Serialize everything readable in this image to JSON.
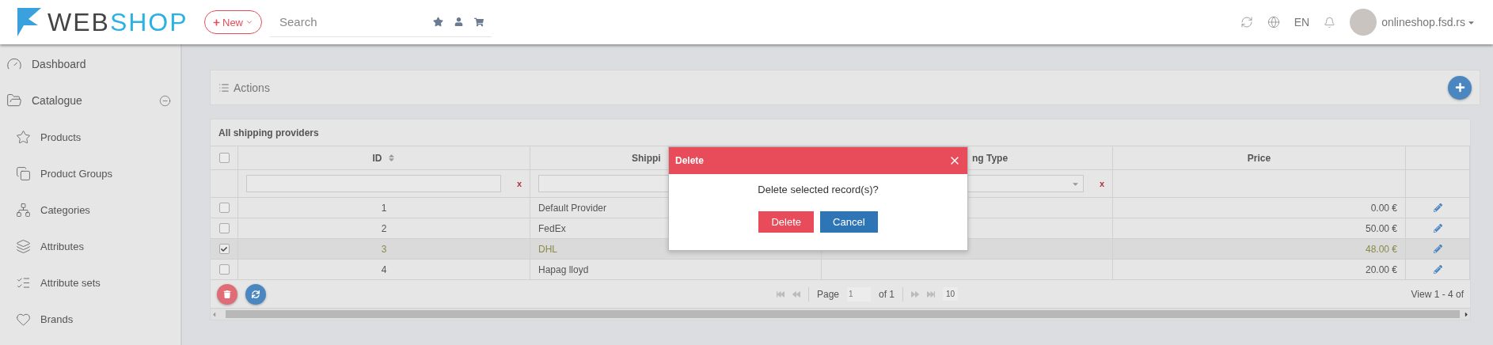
{
  "header": {
    "logo": {
      "dark": "WEB",
      "light": "SHOP"
    },
    "new_button": "New",
    "search": {
      "placeholder": "Search"
    },
    "language": "EN",
    "user": "onlineshop.fsd.rs"
  },
  "sidebar": {
    "items": [
      {
        "label": "Dashboard"
      },
      {
        "label": "Catalogue",
        "expanded": true,
        "children": [
          {
            "label": "Products"
          },
          {
            "label": "Product Groups"
          },
          {
            "label": "Categories"
          },
          {
            "label": "Attributes"
          },
          {
            "label": "Attribute sets"
          },
          {
            "label": "Brands"
          }
        ]
      }
    ]
  },
  "actions": {
    "title": "Actions"
  },
  "table": {
    "title": "All shipping providers",
    "all_selected": false,
    "columns": [
      {
        "label": "ID",
        "sortable": true
      },
      {
        "label": "Shippi"
      },
      {
        "label": "ng Type"
      },
      {
        "label": "Price",
        "sortable": false
      }
    ],
    "filters": [
      {
        "kind": "text",
        "clear": "x"
      },
      {
        "kind": "text"
      },
      {
        "kind": "select",
        "clear": "x"
      }
    ],
    "rows": [
      {
        "id": "1",
        "name": "Default Provider",
        "price": "0.00 €",
        "selected": false
      },
      {
        "id": "2",
        "name": "FedEx",
        "price": "50.00 €",
        "selected": false
      },
      {
        "id": "3",
        "name": "DHL",
        "price": "48.00 €",
        "selected": true
      },
      {
        "id": "4",
        "name": "Hapag lloyd",
        "price": "20.00 €",
        "selected": false
      }
    ],
    "pager": {
      "page_label": "Page",
      "page": "1",
      "of": "of 1",
      "page_size": "10",
      "view": "View 1 - 4 of"
    }
  },
  "dialog": {
    "title": "Delete",
    "message": "Delete selected record(s)?",
    "buttons": [
      {
        "label": "Delete",
        "kind": "danger"
      },
      {
        "label": "Cancel",
        "kind": "primary"
      }
    ]
  }
}
